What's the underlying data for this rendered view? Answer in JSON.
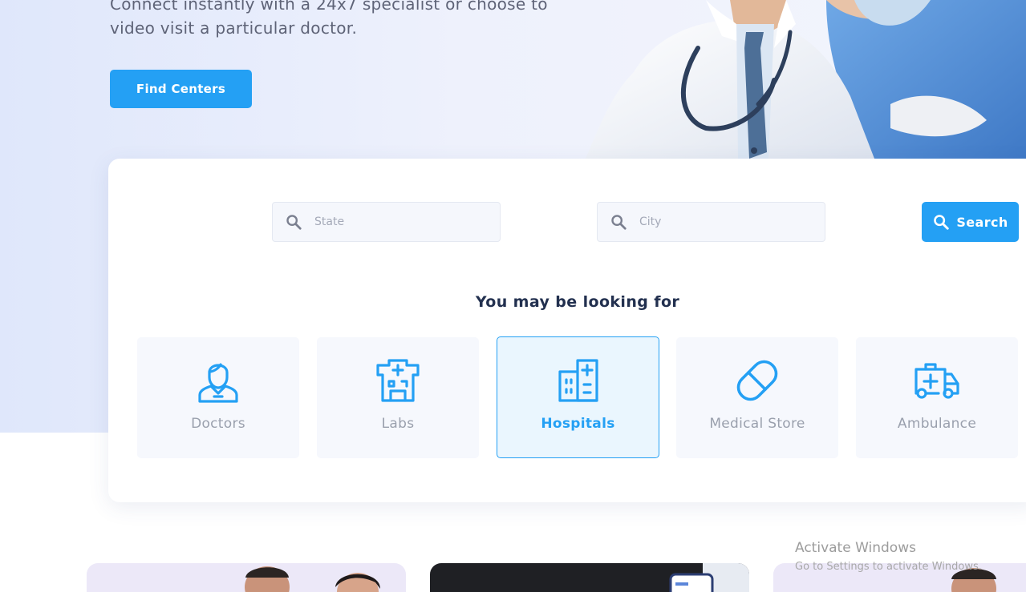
{
  "hero": {
    "line1": "Connect instantly with a 24x7 specialist or choose to",
    "line2": "video visit a particular doctor.",
    "cta_label": "Find Centers"
  },
  "search": {
    "state_placeholder": "State",
    "city_placeholder": "City",
    "button_label": "Search"
  },
  "section": {
    "heading": "You may be looking for"
  },
  "categories": [
    {
      "label": "Doctors",
      "icon": "doctor-icon",
      "active": false
    },
    {
      "label": "Labs",
      "icon": "lab-building-icon",
      "active": false
    },
    {
      "label": "Hospitals",
      "icon": "hospital-icon",
      "active": true
    },
    {
      "label": "Medical Store",
      "icon": "pill-icon",
      "active": false
    },
    {
      "label": "Ambulance",
      "icon": "ambulance-icon",
      "active": false
    }
  ],
  "watermark": {
    "title": "Activate Windows",
    "subtitle": "Go to Settings to activate Windows."
  },
  "colors": {
    "accent": "#24a0f4",
    "heading": "#22304f",
    "muted": "#9aa0ad"
  }
}
